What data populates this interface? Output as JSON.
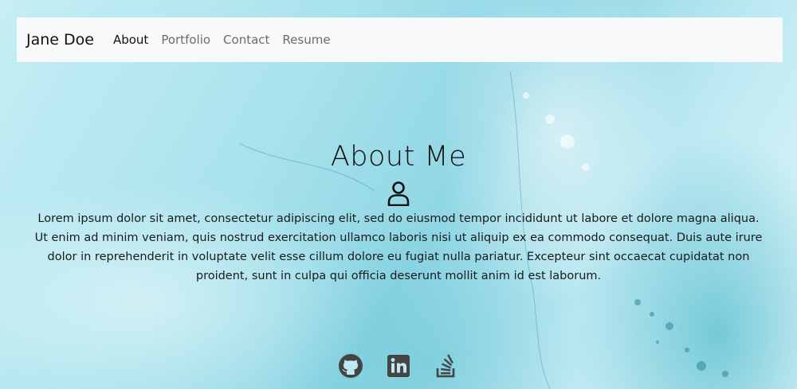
{
  "nav": {
    "brand": "Jane Doe",
    "links": [
      {
        "label": "About",
        "active": true
      },
      {
        "label": "Portfolio",
        "active": false
      },
      {
        "label": "Contact",
        "active": false
      },
      {
        "label": "Resume",
        "active": false
      }
    ]
  },
  "about": {
    "title": "About Me",
    "icon": "person-icon",
    "body": "Lorem ipsum dolor sit amet, consectetur adipiscing elit, sed do eiusmod tempor incididunt ut labore et dolore magna aliqua. Ut enim ad minim veniam, quis nostrud exercitation ullamco laboris nisi ut aliquip ex ea commodo consequat. Duis aute irure dolor in reprehenderit in voluptate velit esse cillum dolore eu fugiat nulla pariatur. Excepteur sint occaecat cupidatat non proident, sunt in culpa qui officia deserunt mollit anim id est laborum."
  },
  "social": {
    "icons": [
      "github-icon",
      "linkedin-icon",
      "stackoverflow-icon"
    ],
    "icon_color": "#444444"
  },
  "colors": {
    "navbar_bg": "#f8f9fa",
    "background": "#a8e2ec"
  }
}
